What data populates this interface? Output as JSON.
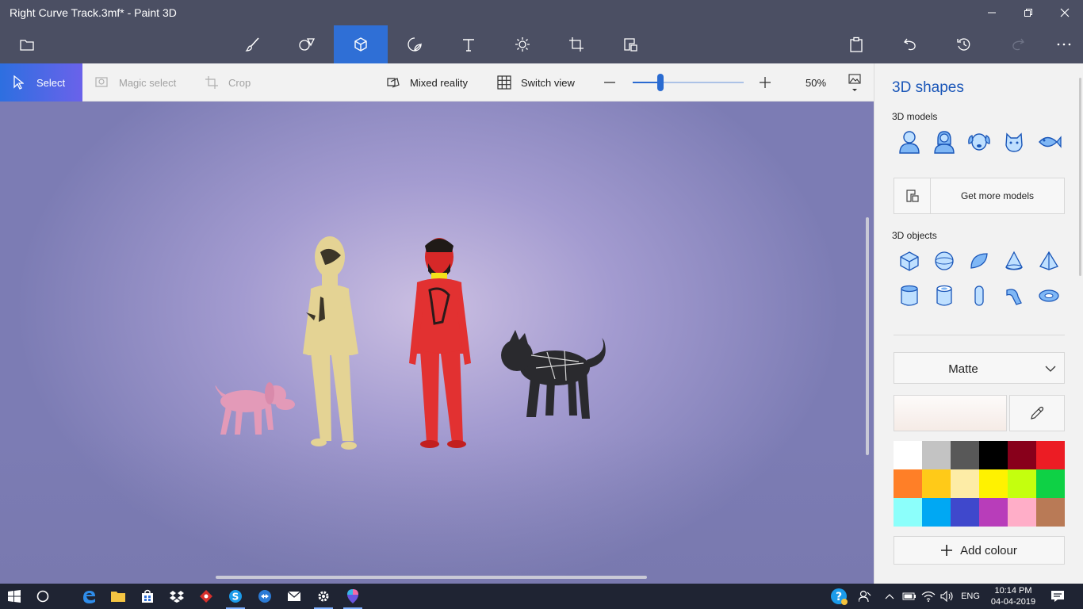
{
  "window": {
    "title": "Right Curve Track.3mf* - Paint 3D"
  },
  "main_toolbar": {
    "left": [
      {
        "name": "menu"
      }
    ],
    "tools": [
      {
        "name": "brushes"
      },
      {
        "name": "2d-shapes"
      },
      {
        "name": "3d-shapes",
        "active": true
      },
      {
        "name": "stickers"
      },
      {
        "name": "text"
      },
      {
        "name": "effects"
      },
      {
        "name": "canvas"
      },
      {
        "name": "remix-3d"
      }
    ],
    "right": [
      {
        "name": "paste"
      },
      {
        "name": "undo"
      },
      {
        "name": "history"
      },
      {
        "name": "redo",
        "disabled": true
      },
      {
        "name": "more"
      }
    ]
  },
  "subtoolbar": {
    "select": "Select",
    "magic_select": "Magic select",
    "crop": "Crop",
    "mixed_reality": "Mixed reality",
    "switch_view": "Switch view",
    "zoom_label": "50%",
    "zoom_value": 50
  },
  "panel": {
    "title": "3D shapes",
    "models_label": "3D models",
    "models": [
      "man",
      "woman",
      "dog",
      "cat",
      "fish"
    ],
    "get_more": "Get more models",
    "objects_label": "3D objects",
    "objects": [
      "cube",
      "sphere",
      "hemisphere",
      "cone",
      "pyramid",
      "cylinder",
      "tube",
      "capsule",
      "curved-tube",
      "donut"
    ],
    "material": "Matte",
    "current_color": "#f5ebe6",
    "palette": [
      "#ffffff",
      "#c3c3c3",
      "#585858",
      "#000000",
      "#88001b",
      "#ec1c24",
      "#ff7f27",
      "#ffca18",
      "#fdeca6",
      "#fff200",
      "#c4ff0e",
      "#0ed145",
      "#8cfffb",
      "#00a8f3",
      "#3f48cc",
      "#b83dba",
      "#ffaec8",
      "#b97a56"
    ],
    "add_colour": "Add colour"
  },
  "taskbar": {
    "apps": [
      "start",
      "cortana",
      "edge",
      "file-explorer",
      "store",
      "dropbox",
      "app-red",
      "skype",
      "teamviewer",
      "mail",
      "settings",
      "paint-3d"
    ],
    "language": "ENG",
    "time": "10:14 PM",
    "date": "04-04-2019"
  }
}
